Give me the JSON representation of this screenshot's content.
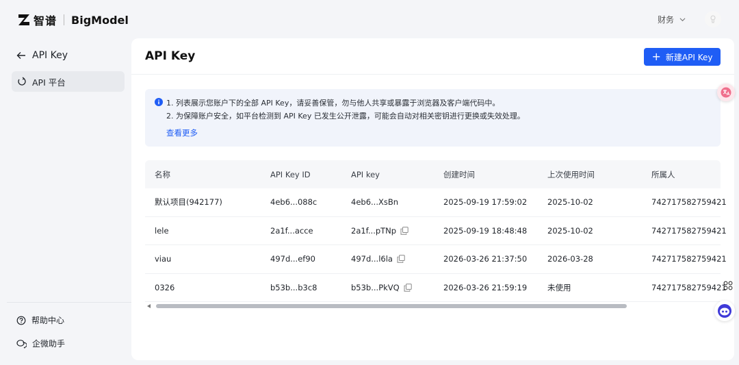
{
  "brand": {
    "cn": "智谱",
    "en": "BigModel"
  },
  "header": {
    "finance_label": "财务"
  },
  "sidebar": {
    "back_label": "API Key",
    "items": [
      {
        "label": "API 平台"
      }
    ],
    "footer": [
      {
        "label": "帮助中心"
      },
      {
        "label": "企微助手"
      }
    ]
  },
  "main": {
    "title": "API Key",
    "new_button_label": "新建API Key",
    "notice": {
      "lines": [
        "1. 列表展示您账户下的全部 API Key，请妥善保管，勿与他人共享或暴露于浏览器及客户端代码中。",
        "2. 为保障账户安全，如平台检测到 API Key 已发生公开泄露，可能会自动对相关密钥进行更换或失效处理。"
      ],
      "more_link": "查看更多"
    },
    "table": {
      "columns": [
        "名称",
        "API Key ID",
        "API key",
        "创建时间",
        "上次使用时间",
        "所属人"
      ],
      "rows": [
        {
          "name": "默认项目(942177)",
          "key_id": "4eb6...088c",
          "api_key": "4eb6...XsBn",
          "copy": false,
          "created": "2025-09-19 17:59:02",
          "last_used": "2025-10-02",
          "owner": "742717582759421"
        },
        {
          "name": "lele",
          "key_id": "2a1f...acce",
          "api_key": "2a1f...pTNp",
          "copy": true,
          "created": "2025-09-19 18:48:48",
          "last_used": "2025-10-02",
          "owner": "742717582759421"
        },
        {
          "name": "viau",
          "key_id": "497d...ef90",
          "api_key": "497d...l6la",
          "copy": true,
          "created": "2026-03-26 21:37:50",
          "last_used": "2026-03-28",
          "owner": "742717582759421"
        },
        {
          "name": "0326",
          "key_id": "b53b...b3c8",
          "api_key": "b53b...PkVQ",
          "copy": true,
          "created": "2026-03-26 21:59:19",
          "last_used": "未使用",
          "owner": "742717582759421"
        }
      ]
    }
  },
  "colors": {
    "accent": "#1f5df5",
    "notice_bg": "#f1f4fb",
    "nav_active_bg": "#e8eaee"
  },
  "icons": [
    "logo-z-icon",
    "chevron-down-icon",
    "avatar-icon",
    "arrow-left-icon",
    "platform-icon",
    "info-icon",
    "copy-icon",
    "help-icon",
    "chat-icon",
    "translate-icon",
    "apps-icon",
    "bot-icon"
  ]
}
